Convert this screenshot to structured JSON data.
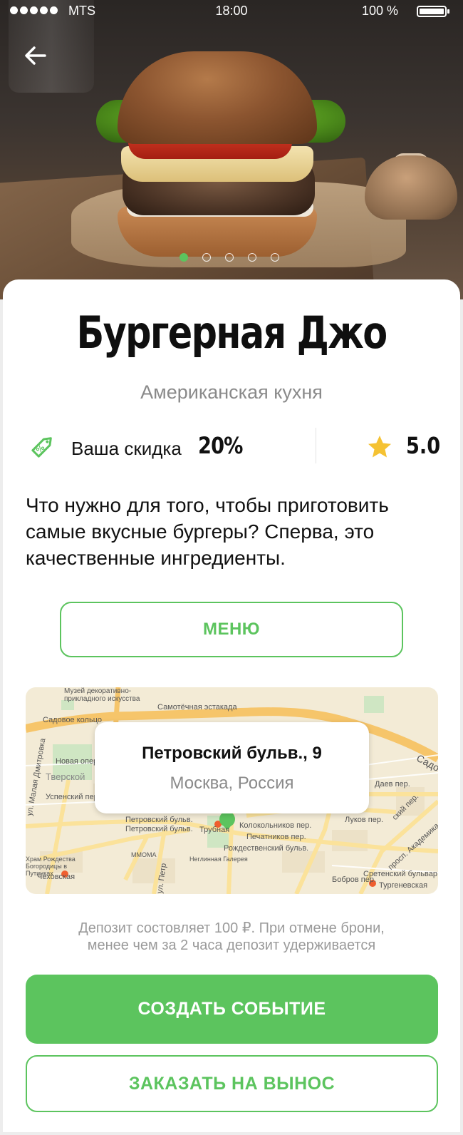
{
  "status_bar": {
    "carrier": "MTS",
    "time": "18:00",
    "battery": "100 %"
  },
  "gallery": {
    "slides_total": 5,
    "active_slide": 1
  },
  "restaurant": {
    "name": "Бургерная Джо",
    "cuisine": "Американская кухня",
    "discount_label": "Ваша скидка",
    "discount_value": "20%",
    "rating": "5.0",
    "description": "Что нужно для того, чтобы приготовить самые вкусные бургеры? Сперва, это качественные ингредиенты."
  },
  "actions": {
    "menu_label": "МЕНЮ",
    "create_event_label": "СОЗДАТЬ СОБЫТИЕ",
    "takeaway_label": "ЗАКАЗАТЬ НА ВЫНОС"
  },
  "map": {
    "address_street": "Петровский бульв., 9",
    "address_city": "Москва, Россия",
    "labels": {
      "museum": "Музей декоративно-прикладного искусства",
      "sadovoe": "Садовое кольцо",
      "samotechnaya": "Самотёчная эстакада",
      "novaya_opera": "Новая опера",
      "tverskoy": "Тверской",
      "malaya_dmitrovka": "ул. Малая Дмитровка",
      "uspensky": "Успенский пер.",
      "petrovsky_bulv": "Петровский бульв.",
      "petrovsky_bulv2": "Петровский бульв.",
      "truba": "Трубная",
      "kolokolny": "Колокольников пер.",
      "pechatnikov": "Печатников пер.",
      "rozhdestvensky": "Рождественский бульв.",
      "neglinnaya": "Неглинная Галерея",
      "mmoma": "ММОМА",
      "khram": "Храм Рождества Богородицы в Путинках",
      "chekhovskaya": "Чеховская",
      "lukov": "Луков пер.",
      "dalev": "Даев пер.",
      "akademika": "просп. Академика Сах",
      "sretensky": "Сретенский бульвар",
      "turgenevskaya": "Тургеневская",
      "bobrov": "Бобров пер.",
      "sado_right": "Садо",
      "ul_petr": "ул. Петр",
      "ul_tsv": "Цв",
      "ashinsky": "ский пер."
    }
  },
  "deposit_note_line1": "Депозит состовляет 100 ₽. При отмене брони,",
  "deposit_note_line2": "менее чем за 2 часа депозит удерживается",
  "colors": {
    "accent": "#5cc45e",
    "star": "#f5c232",
    "muted_text": "#8a8a8a"
  },
  "icons": {
    "back": "arrow-left-icon",
    "discount": "tag-percent-icon",
    "rating": "star-icon",
    "map_pin": "map-pin-icon",
    "metro": "metro-icon"
  }
}
